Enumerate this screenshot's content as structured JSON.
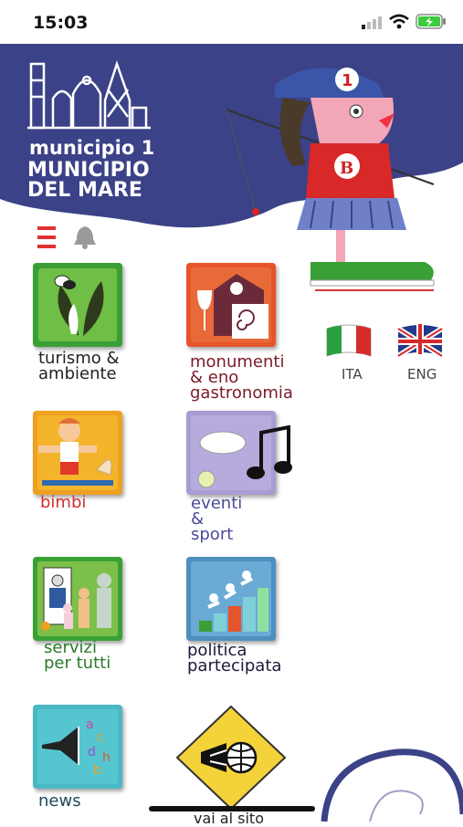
{
  "status_bar": {
    "time": "15:03"
  },
  "logo": {
    "line1": "municipio 1",
    "line2": "MUNICIPIO DEL MARE"
  },
  "languages": [
    {
      "label": "ITA"
    },
    {
      "label": "ENG"
    }
  ],
  "tiles": [
    {
      "label": "turismo &\nambiente"
    },
    {
      "label": "monumenti\n& eno\ngastronomia"
    },
    {
      "label": "bimbi"
    },
    {
      "label": "eventi\n&\nsport"
    },
    {
      "label": "servizi\nper tutti"
    },
    {
      "label": "politica\npartecipata"
    },
    {
      "label": "news"
    },
    {
      "label": "vai al sito"
    }
  ],
  "colors": {
    "header_blue": "#3b4287",
    "green": "#3aa035",
    "orange": "#e6552a",
    "yellow_orange": "#f0a020",
    "lavender": "#a99bd3",
    "steel_blue": "#4f8fbf",
    "teal": "#49b8c4"
  }
}
